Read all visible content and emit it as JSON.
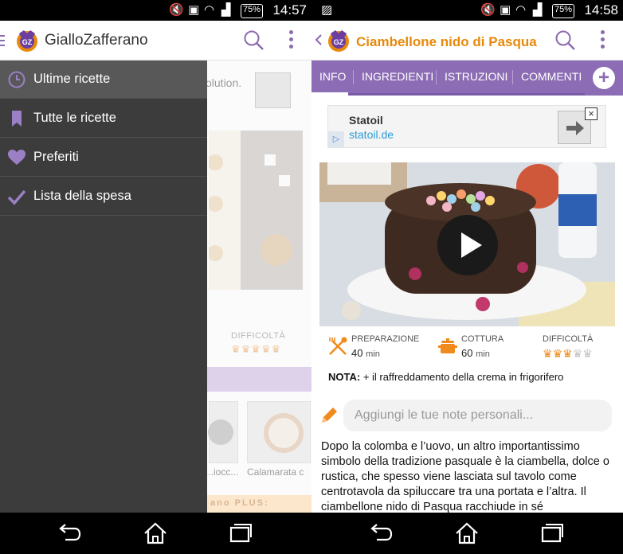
{
  "left": {
    "status": {
      "time": "14:57",
      "battery": "75%"
    },
    "appbar": {
      "title": "GialloZafferano",
      "logo_text": "GZ"
    },
    "background": {
      "ad_text": "olution.",
      "difficulty_label": "DIFFICOLTÀ",
      "difficulty_chefs": "♛♛♛♛♛",
      "card_captions": [
        "...iocc...",
        "Calamarata c"
      ],
      "plus_banner": "ano PLUS:"
    },
    "drawer": {
      "items": [
        {
          "label": "Ultime ricette",
          "icon": "clock-icon",
          "active": true
        },
        {
          "label": "Tutte le ricette",
          "icon": "bookmark-icon",
          "active": false
        },
        {
          "label": "Preferiti",
          "icon": "heart-icon",
          "active": false
        },
        {
          "label": "Lista della spesa",
          "icon": "check-icon",
          "active": false
        }
      ]
    }
  },
  "right": {
    "status": {
      "time": "14:58",
      "battery": "75%"
    },
    "appbar": {
      "title": "Ciambellone nido di Pasqua",
      "logo_text": "GZ"
    },
    "tabs": [
      "INFO",
      "INGREDIENTI",
      "ISTRUZIONI",
      "COMMENTI ("
    ],
    "active_tab": "INFO",
    "ad": {
      "title": "Statoil",
      "url": "statoil.de",
      "info_icon": "ad-choices-icon",
      "close": "×"
    },
    "info": {
      "preparazione": {
        "label": "PREPARAZIONE",
        "value": "40",
        "unit": "min"
      },
      "cottura": {
        "label": "COTTURA",
        "value": "60",
        "unit": "min"
      },
      "difficolta": {
        "label": "DIFFICOLTÀ",
        "level": 3,
        "max": 5
      }
    },
    "nota": {
      "label": "NOTA:",
      "text": "+ il raffreddamento della crema in frigorifero"
    },
    "notes": {
      "placeholder": "Aggiungi le tue note personali..."
    },
    "description": "Dopo la colomba e l’uovo, un altro importantissimo simbolo della tradizione pasquale è la ciambella, dolce o rustica, che spesso viene lasciata sul tavolo come centrotavola da spiluccare tra una portata e l’altra. Il ciambellone nido di Pasqua racchiude in sé"
  },
  "colors": {
    "accent_purple": "#8c6cb4",
    "accent_orange": "#e8890c",
    "drawer_bg": "#3c3c3c"
  }
}
